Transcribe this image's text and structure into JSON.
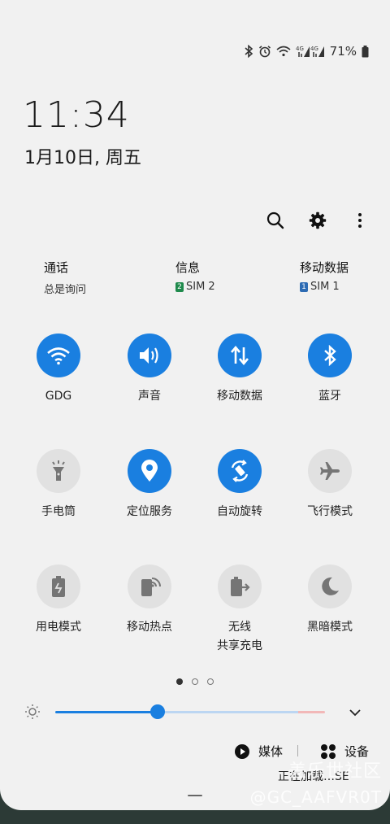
{
  "status": {
    "battery": "71%",
    "icons": [
      "bluetooth-icon",
      "alarm-icon",
      "wifi-icon",
      "4g-signal-icon",
      "battery-icon"
    ]
  },
  "clock": {
    "time": "11:34",
    "date": "1月10日, 周五"
  },
  "header_icons": [
    "search-icon",
    "settings-icon",
    "more-icon"
  ],
  "sim": [
    {
      "title": "通话",
      "sub": "总是询问",
      "badge": ""
    },
    {
      "title": "信息",
      "sub": "SIM 2",
      "badge": "2",
      "badge_color": "#1f8a4c"
    },
    {
      "title": "移动数据",
      "sub": "SIM 1",
      "badge": "1",
      "badge_color": "#2d6bb3"
    }
  ],
  "tiles": [
    {
      "label": "GDG",
      "on": true,
      "icon": "wifi-icon"
    },
    {
      "label": "声音",
      "on": true,
      "icon": "sound-icon"
    },
    {
      "label": "移动数据",
      "on": true,
      "icon": "mobile-data-icon"
    },
    {
      "label": "蓝牙",
      "on": true,
      "icon": "bluetooth-icon"
    },
    {
      "label": "手电筒",
      "on": false,
      "icon": "flashlight-icon"
    },
    {
      "label": "定位服务",
      "on": true,
      "icon": "location-icon"
    },
    {
      "label": "自动旋转",
      "on": true,
      "icon": "auto-rotate-icon"
    },
    {
      "label": "飞行模式",
      "on": false,
      "icon": "airplane-icon"
    },
    {
      "label": "用电模式",
      "on": false,
      "icon": "power-mode-icon"
    },
    {
      "label": "移动热点",
      "on": false,
      "icon": "hotspot-icon"
    },
    {
      "label": "无线\n共享充电",
      "on": false,
      "icon": "wireless-powershare-icon"
    },
    {
      "label": "黑暗模式",
      "on": false,
      "icon": "dark-mode-icon"
    }
  ],
  "pager": {
    "pages": 3,
    "current": 1
  },
  "brightness": {
    "level": 0.38
  },
  "bottom": {
    "media": "媒体",
    "devices": "设备"
  },
  "watermark": {
    "line1": "盖乐世社区",
    "line2": "@GC_AAFVR0T",
    "peek": "正在加载…SE"
  }
}
